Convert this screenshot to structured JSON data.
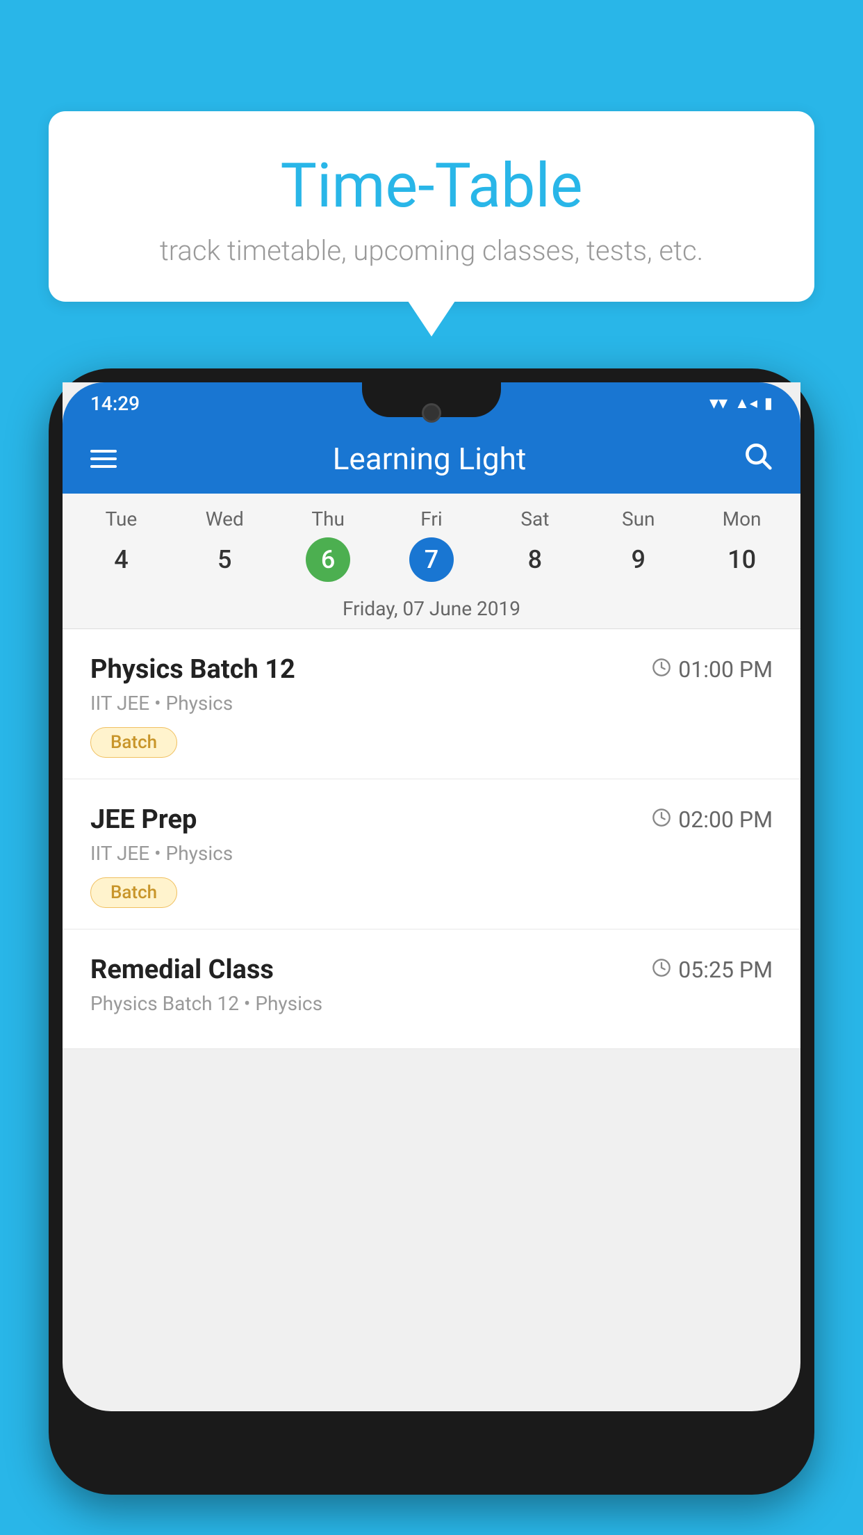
{
  "background_color": "#29b6e8",
  "bubble": {
    "title": "Time-Table",
    "subtitle": "track timetable, upcoming classes, tests, etc."
  },
  "status_bar": {
    "time": "14:29"
  },
  "app_header": {
    "title": "Learning Light"
  },
  "calendar": {
    "selected_date_label": "Friday, 07 June 2019",
    "days": [
      {
        "name": "Tue",
        "number": "4",
        "state": "normal"
      },
      {
        "name": "Wed",
        "number": "5",
        "state": "normal"
      },
      {
        "name": "Thu",
        "number": "6",
        "state": "today"
      },
      {
        "name": "Fri",
        "number": "7",
        "state": "selected"
      },
      {
        "name": "Sat",
        "number": "8",
        "state": "normal"
      },
      {
        "name": "Sun",
        "number": "9",
        "state": "normal"
      },
      {
        "name": "Mon",
        "number": "10",
        "state": "normal"
      }
    ]
  },
  "schedule_items": [
    {
      "title": "Physics Batch 12",
      "time": "01:00 PM",
      "subtitle": "IIT JEE • Physics",
      "tag": "Batch"
    },
    {
      "title": "JEE Prep",
      "time": "02:00 PM",
      "subtitle": "IIT JEE • Physics",
      "tag": "Batch"
    },
    {
      "title": "Remedial Class",
      "time": "05:25 PM",
      "subtitle": "Physics Batch 12 • Physics",
      "tag": null
    }
  ],
  "icons": {
    "hamburger": "≡",
    "search": "🔍",
    "clock": "🕐"
  }
}
